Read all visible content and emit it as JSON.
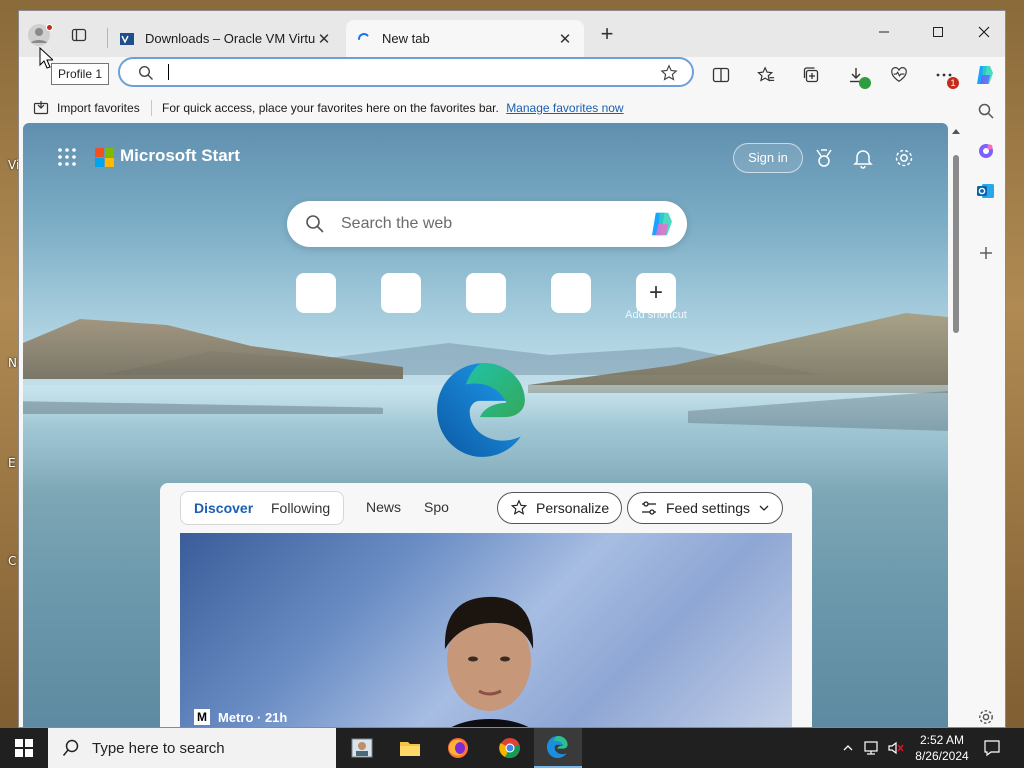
{
  "desktop": {
    "edge_letters": [
      "Vi",
      "N",
      "E",
      "C"
    ]
  },
  "browser": {
    "profile_tooltip": "Profile 1",
    "tabs": [
      {
        "title": "Downloads – Oracle VM VirtualBox",
        "active": false
      },
      {
        "title": "New tab",
        "active": true
      }
    ],
    "address_bar": {
      "value": "",
      "placeholder": ""
    },
    "favorites_bar": {
      "import_label": "Import favorites",
      "message": "For quick access, place your favorites here on the favorites bar.",
      "link": "Manage favorites now"
    },
    "downloads_badge": "",
    "extensions_badge": "1"
  },
  "newtab": {
    "brand": "Microsoft Start",
    "sign_in": "Sign in",
    "search_placeholder": "Search the web",
    "add_shortcut_label": "Add shortcut",
    "feed": {
      "tabs": [
        "Discover",
        "Following"
      ],
      "more_tabs": [
        "News",
        "Spo"
      ],
      "personalize": "Personalize",
      "feed_settings": "Feed settings",
      "hero_source": "Metro · 21h"
    }
  },
  "taskbar": {
    "search_placeholder": "Type here to search",
    "time": "2:52 AM",
    "date": "8/26/2024"
  },
  "colors": {
    "accent": "#1a5fb4",
    "ms_red": "#f25022",
    "ms_green": "#7fba00",
    "ms_blue": "#00a4ef",
    "ms_yellow": "#ffb900"
  }
}
